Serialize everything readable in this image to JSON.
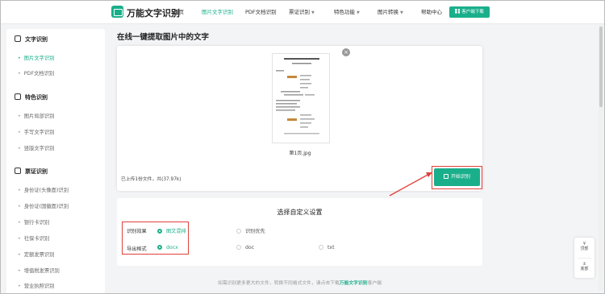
{
  "brand": {
    "name": "万能文字识别"
  },
  "nav": {
    "items": [
      "首页",
      "图片文字识别",
      "PDF文档识别",
      "票证识别",
      "特色功能",
      "图片转换",
      "帮助中心"
    ],
    "download_label": "客户端下载"
  },
  "sidebar": {
    "sections": [
      {
        "title": "文字识别",
        "items": [
          "图片文字识别",
          "PDF文档识别"
        ]
      },
      {
        "title": "特色识别",
        "items": [
          "图片局部识别",
          "手写文字识别",
          "竖版文字识别"
        ]
      },
      {
        "title": "票证识别",
        "items": [
          "身份证(头像面)识别",
          "身份证(国徽面)识别",
          "银行卡识别",
          "社保卡识别",
          "定额发票识别",
          "增值税发票识别",
          "营业执照识别"
        ]
      }
    ]
  },
  "main": {
    "title": "在线一键提取图片中的文字",
    "file_name": "第1页.jpg",
    "upload_status": "已上传1份文件，共(37.97k)",
    "start_label": "开始识别"
  },
  "settings": {
    "title": "选择自定义设置",
    "effect_label": "识别效果",
    "effect_options": [
      "图文混排",
      "识别优先"
    ],
    "format_label": "导出格式",
    "format_options": [
      "docx",
      "doc",
      "txt"
    ],
    "selected_effect": "图文混排",
    "selected_format": "docx"
  },
  "footer": {
    "before": "如需识别更多更大的文件，转换不同格式文件，请点击下载",
    "link": "万能文字识别",
    "after": "客户端"
  },
  "float": {
    "top": "顶部",
    "bottom": "底部"
  },
  "colors": {
    "accent": "#1aaf8b",
    "highlight": "#e0403a"
  }
}
